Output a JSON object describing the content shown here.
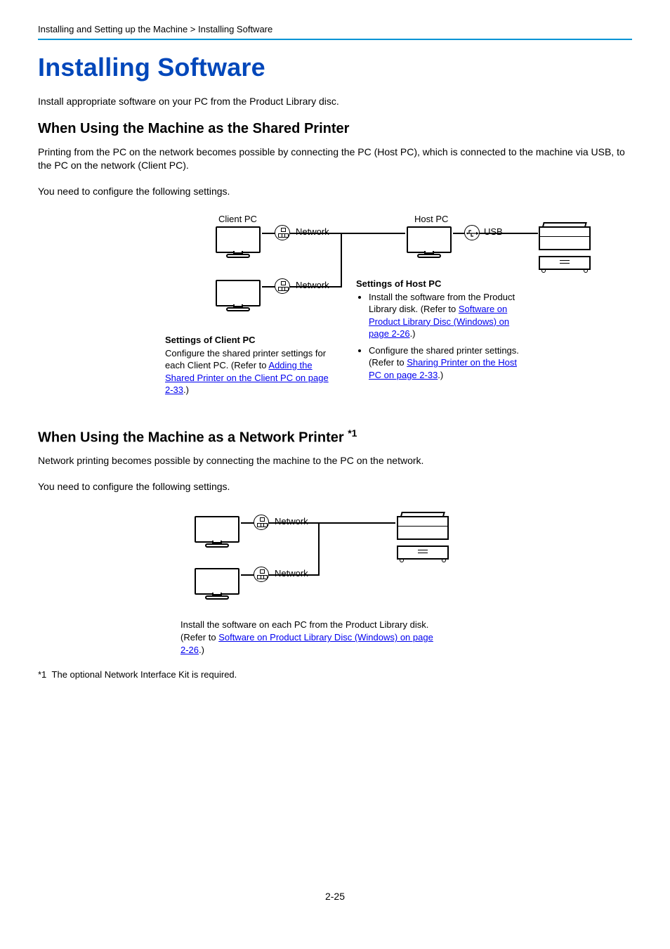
{
  "breadcrumb": "Installing and Setting up the Machine > Installing Software",
  "h1": "Installing Software",
  "intro": "Install appropriate software on your PC from the Product Library disc.",
  "shared": {
    "title": "When Using the Machine as the Shared Printer",
    "p1": "Printing from the PC on the network becomes possible by connecting the PC (Host PC), which is connected to the machine via USB, to the PC on the network (Client PC).",
    "p2": "You need to configure the following settings.",
    "client_pc": "Client PC",
    "host_pc": "Host PC",
    "network": "Network",
    "usb": "USB",
    "settings_client_title": "Settings of Client PC",
    "settings_client_pre": "Configure the shared printer settings for each Client PC. (Refer to ",
    "settings_client_link": "Adding the Shared Printer on the Client PC on page 2-33",
    "settings_client_post": ".)",
    "settings_host_title": "Settings of Host PC",
    "host_b1_pre": "Install the software from the Product Library disk. (Refer to ",
    "host_b1_link": "Software on Product Library Disc (Windows) on page 2-26",
    "host_b1_post": ".)",
    "host_b2_pre": "Configure the shared printer settings. (Refer to ",
    "host_b2_link": "Sharing Printer on the Host PC on page 2-33",
    "host_b2_post": ".)"
  },
  "network": {
    "title_pre": "When Using the Machine as a Network Printer ",
    "title_sup": "*1",
    "p1": "Network printing becomes possible by connecting the machine to the PC on the network.",
    "p2": "You need to configure the following settings.",
    "label": "Network",
    "txt_pre": "Install the software on each PC from the Product Library disk. (Refer to ",
    "txt_link": "Software on Product Library Disc (Windows) on page 2-26",
    "txt_post": ".)"
  },
  "footnote_label": "*1",
  "footnote_text": "The optional Network Interface Kit is required.",
  "page_num": "2-25"
}
